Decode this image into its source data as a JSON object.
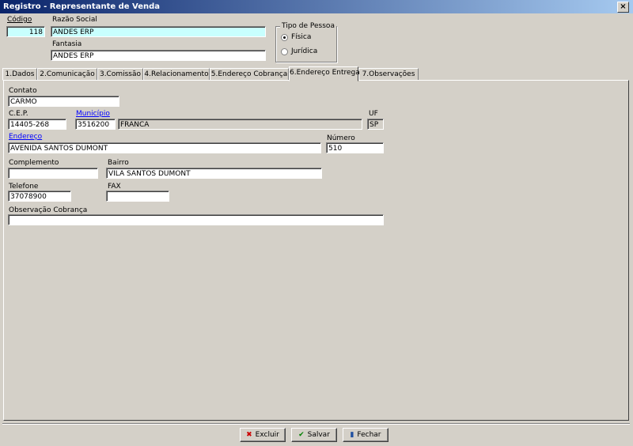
{
  "window": {
    "title": "Registro - Representante de Venda",
    "close_glyph": "×"
  },
  "header": {
    "codigo_label": "Código",
    "codigo_value": "118",
    "razao_label": "Razão Social",
    "razao_value": "ANDES ERP",
    "fantasia_label": "Fantasia",
    "fantasia_value": "ANDES ERP",
    "tipo_pessoa": {
      "legend": "Tipo de Pessoa",
      "options": [
        "Física",
        "Jurídica"
      ],
      "selected": "Física"
    }
  },
  "tabs": [
    {
      "label": "1.Dados"
    },
    {
      "label": "2.Comunicação"
    },
    {
      "label": "3.Comissão"
    },
    {
      "label": "4.Relacionamento"
    },
    {
      "label": "5.Endereço Cobrança"
    },
    {
      "label": "6.Endereço Entrega"
    },
    {
      "label": "7.Observações"
    }
  ],
  "active_tab": "6.Endereço Entrega",
  "form": {
    "contato_label": "Contato",
    "contato_value": "CARMO",
    "cep_label": "C.E.P.",
    "cep_value": "14405-268",
    "municipio_label": "Município",
    "municipio_code": "3516200",
    "municipio_name": "FRANCA",
    "uf_label": "UF",
    "uf_value": "SP",
    "endereco_label": "Endereço",
    "endereco_value": "AVENIDA SANTOS DUMONT",
    "numero_label": "Número",
    "numero_value": "510",
    "complemento_label": "Complemento",
    "complemento_value": "",
    "bairro_label": "Bairro",
    "bairro_value": "VILA SANTOS DUMONT",
    "telefone_label": "Telefone",
    "telefone_value": "37078900",
    "fax_label": "FAX",
    "fax_value": "",
    "obs_cobranca_label": "Observação Cobrança",
    "obs_cobranca_value": ""
  },
  "footer": {
    "excluir_label": "Excluir",
    "salvar_label": "Salvar",
    "fechar_label": "Fechar",
    "excluir_icon": "red-x-icon",
    "salvar_icon": "green-check-icon",
    "fechar_icon": "door-icon",
    "colors": {
      "excluir": "#cc0000",
      "salvar": "#008000",
      "fechar": "#1f4fa0"
    }
  }
}
